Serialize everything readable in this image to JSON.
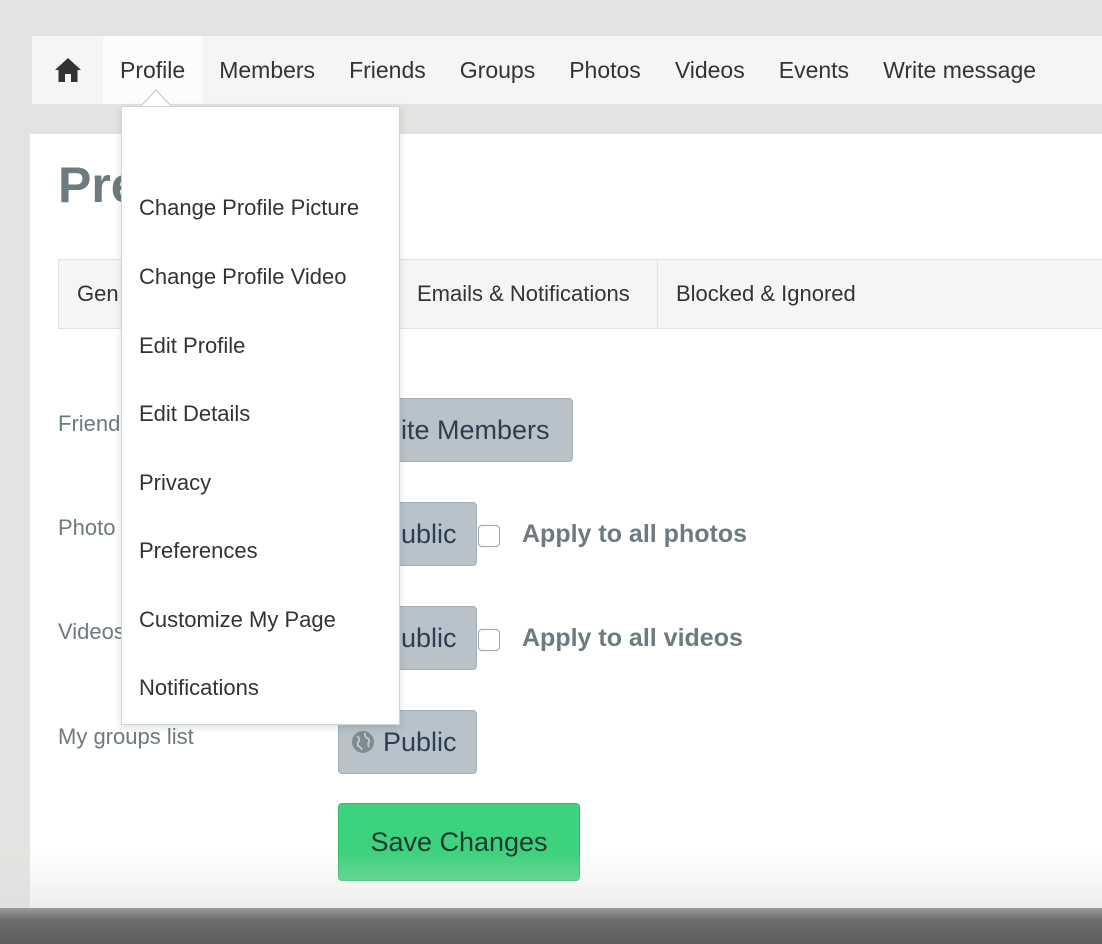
{
  "nav": {
    "home_icon": "home-icon",
    "items": [
      {
        "label": "Profile"
      },
      {
        "label": "Members"
      },
      {
        "label": "Friends"
      },
      {
        "label": "Groups"
      },
      {
        "label": "Photos"
      },
      {
        "label": "Videos"
      },
      {
        "label": "Events"
      },
      {
        "label": "Write message"
      }
    ]
  },
  "dropdown": {
    "items": [
      {
        "label": "Change Profile Picture"
      },
      {
        "label": "Change Profile Video"
      },
      {
        "label": "Edit Profile"
      },
      {
        "label": "Edit Details"
      },
      {
        "label": "Privacy"
      },
      {
        "label": "Preferences"
      },
      {
        "label": "Customize My Page"
      },
      {
        "label": "Notifications"
      }
    ]
  },
  "page": {
    "title": "Pre",
    "tabs": [
      {
        "label": "Gen"
      },
      {
        "label": "Emails & Notifications"
      },
      {
        "label": "Blocked & Ignored"
      }
    ]
  },
  "privacy": {
    "rows": [
      {
        "label": "Friend",
        "value": "Site Members"
      },
      {
        "label": "Photo",
        "value": "Public",
        "apply_label": "Apply to all photos"
      },
      {
        "label": "Videos",
        "value": "Public",
        "apply_label": "Apply to all videos"
      },
      {
        "label": "My groups list",
        "value": "Public"
      }
    ],
    "save_label": "Save Changes"
  },
  "colors": {
    "save_button": "#3dd27e",
    "privacy_button": "#b8c2ca",
    "muted_text": "#6d7a80"
  }
}
